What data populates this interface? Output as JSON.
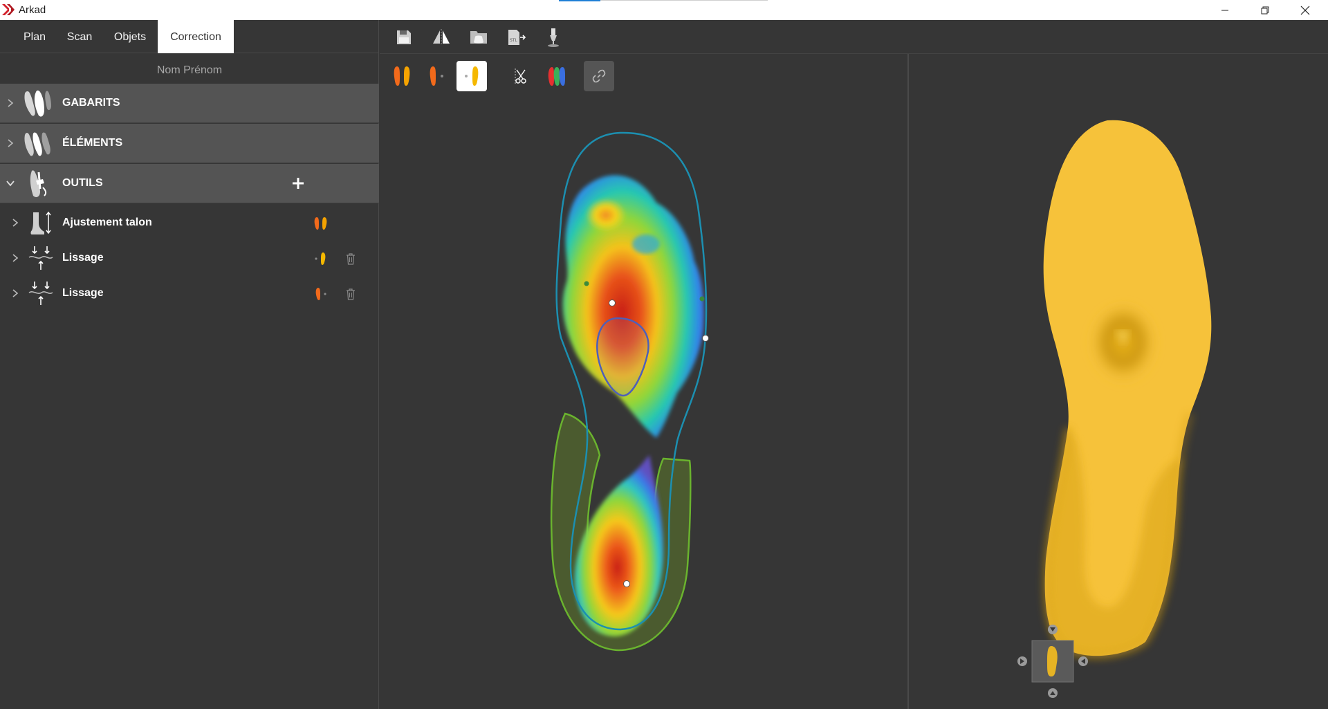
{
  "window": {
    "title": "Arkad"
  },
  "tabs": [
    {
      "label": "Plan",
      "active": false
    },
    {
      "label": "Scan",
      "active": false
    },
    {
      "label": "Objets",
      "active": false
    },
    {
      "label": "Correction",
      "active": true
    }
  ],
  "patient": {
    "name": "Nom Prénom"
  },
  "sections": [
    {
      "label": "GABARITS",
      "expanded": false
    },
    {
      "label": "ÉLÉMENTS",
      "expanded": false
    },
    {
      "label": "OUTILS",
      "expanded": true,
      "add_label": "+"
    }
  ],
  "tools": [
    {
      "label": "Ajustement talon",
      "feet": "both",
      "deletable": false
    },
    {
      "label": "Lissage",
      "feet": "right",
      "deletable": true
    },
    {
      "label": "Lissage",
      "feet": "left",
      "deletable": true
    }
  ],
  "colors": {
    "accent_orange": "#f26a1b",
    "accent_yellow": "#f5b800",
    "insole": "#f6c23a",
    "panel_bg": "#363636",
    "section_bg": "#545454"
  },
  "toolbar": {
    "icons": [
      "save-icon",
      "mirror-icon",
      "export-icon",
      "stl-export-icon",
      "machine-icon"
    ]
  },
  "view_tools": {
    "icons": [
      "both-feet-icon",
      "left-foot-icon",
      "right-foot-icon",
      "cut-icon",
      "colormap-icon",
      "link-icon"
    ],
    "selected": "right-foot-icon"
  }
}
